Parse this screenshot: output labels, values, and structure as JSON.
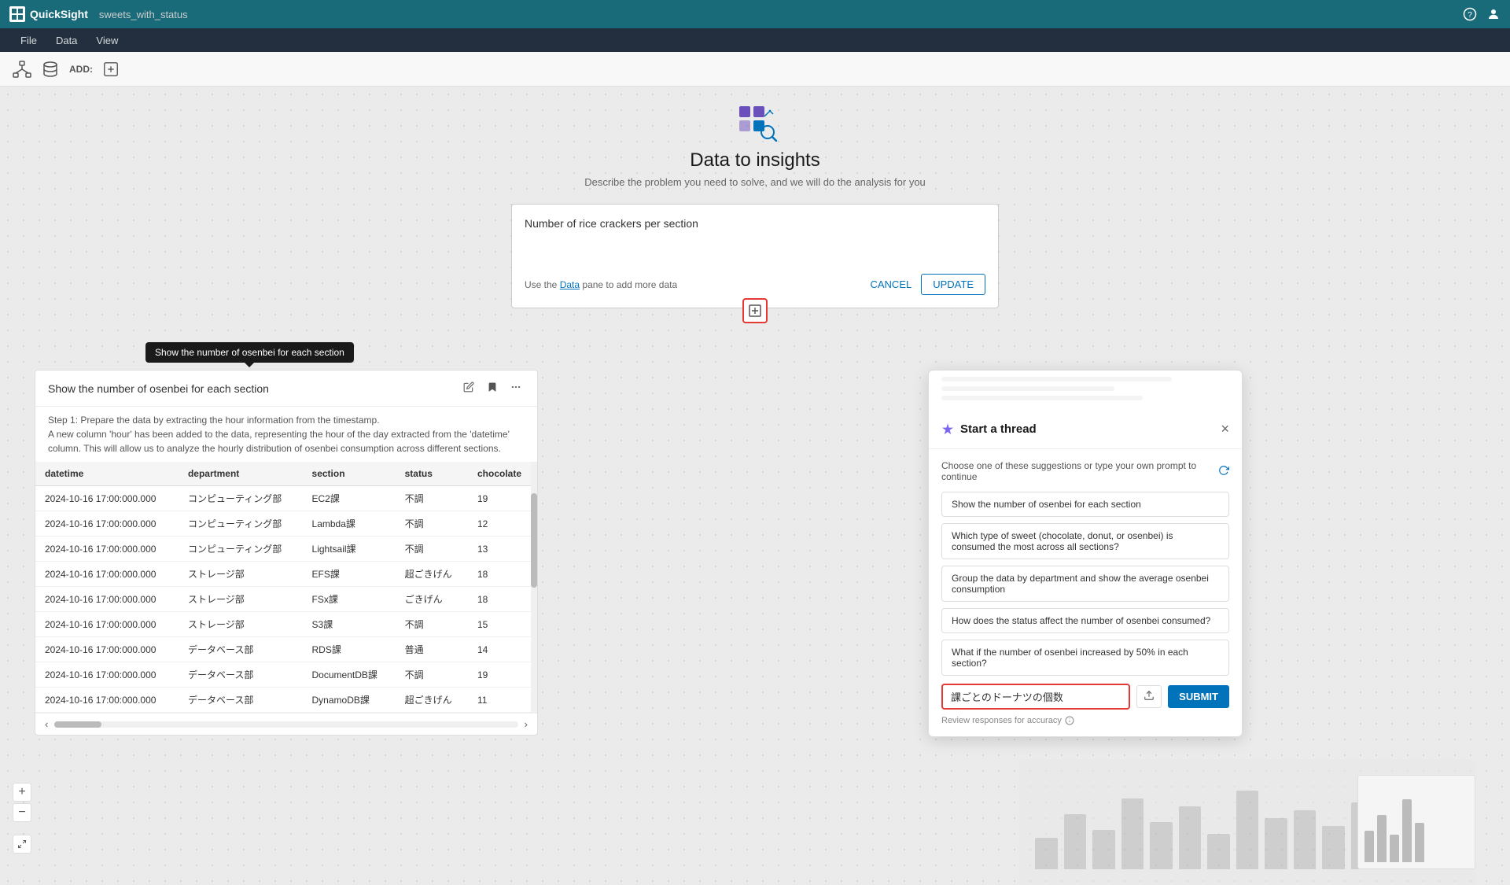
{
  "app": {
    "name": "QuickSight",
    "tab": "sweets_with_status"
  },
  "menubar": {
    "items": [
      "File",
      "Data",
      "View"
    ]
  },
  "toolbar": {
    "add_label": "ADD:"
  },
  "center": {
    "title": "Data to insights",
    "subtitle": "Describe the problem you need to solve, and we will do the analysis for you",
    "query": "Number of rice crackers per section",
    "hint": "Use the Data pane to add more data",
    "cancel_label": "CANCEL",
    "update_label": "UPDATE"
  },
  "tooltip": {
    "text": "Show the number of osenbei for each section"
  },
  "data_panel": {
    "title": "Show the number of osenbei for each section",
    "description": "Step 1: Prepare the data by extracting the hour information from the timestamp.\nA new column 'hour' has been added to the data, representing the hour of the day extracted from the 'datetime' column. This will allow us to analyze the hourly distribution of osenbei consumption across different sections.",
    "columns": [
      "datetime",
      "department",
      "section",
      "status",
      "chocolate"
    ],
    "rows": [
      [
        "2024-10-16 17:00:000.000",
        "コンピューティング部",
        "EC2課",
        "不調",
        "19"
      ],
      [
        "2024-10-16 17:00:000.000",
        "コンピューティング部",
        "Lambda課",
        "不調",
        "12"
      ],
      [
        "2024-10-16 17:00:000.000",
        "コンピューティング部",
        "Lightsail課",
        "不調",
        "13"
      ],
      [
        "2024-10-16 17:00:000.000",
        "ストレージ部",
        "EFS課",
        "超ごきげん",
        "18"
      ],
      [
        "2024-10-16 17:00:000.000",
        "ストレージ部",
        "FSx課",
        "ごきげん",
        "18"
      ],
      [
        "2024-10-16 17:00:000.000",
        "ストレージ部",
        "S3課",
        "不調",
        "15"
      ],
      [
        "2024-10-16 17:00:000.000",
        "データベース部",
        "RDS課",
        "普通",
        "14"
      ],
      [
        "2024-10-16 17:00:000.000",
        "データベース部",
        "DocumentDB課",
        "不調",
        "19"
      ],
      [
        "2024-10-16 17:00:000.000",
        "データベース部",
        "DynamoDB課",
        "超ごきげん",
        "11"
      ]
    ]
  },
  "thread": {
    "title": "Start a thread",
    "description": "Choose one of these suggestions or type your own prompt to continue",
    "suggestions": [
      "Show the number of osenbei for each section",
      "Which type of sweet (chocolate, donut, or osenbei) is consumed the most across all sections?",
      "Group the data by department and show the average osenbei consumption",
      "How does the status affect the number of osenbei consumed?",
      "What if the number of osenbei increased by 50% in each section?"
    ],
    "input_value": "課ごとのドーナツの個数",
    "input_placeholder": "課ごとのドーナツの個数",
    "submit_label": "SUBMIT",
    "review_note": "Review responses for accuracy"
  },
  "zoom": {
    "plus": "+",
    "minus": "−"
  }
}
